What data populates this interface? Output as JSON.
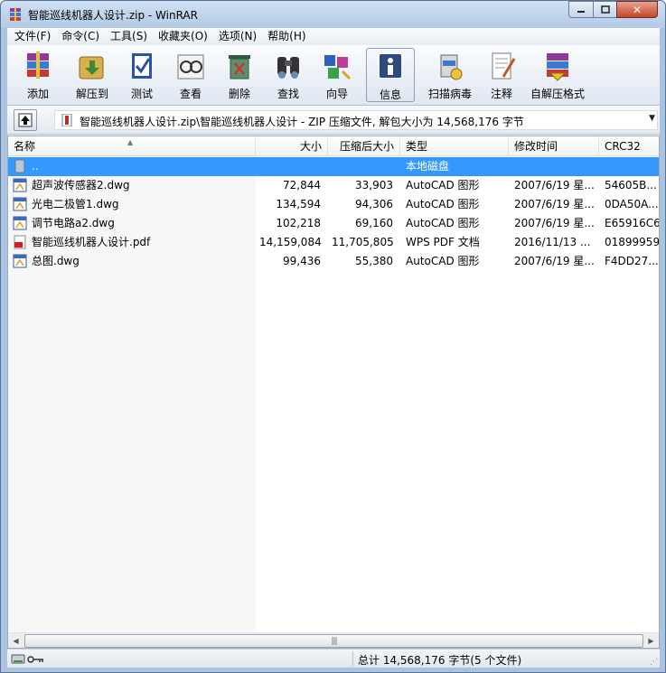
{
  "window": {
    "title": "智能巡线机器人设计.zip - WinRAR"
  },
  "menu": [
    "文件(F)",
    "命令(C)",
    "工具(S)",
    "收藏夹(O)",
    "选项(N)",
    "帮助(H)"
  ],
  "toolbar": [
    {
      "label": "添加",
      "icon": "add-archive-icon"
    },
    {
      "label": "解压到",
      "icon": "extract-to-icon"
    },
    {
      "label": "测试",
      "icon": "test-icon"
    },
    {
      "label": "查看",
      "icon": "view-icon"
    },
    {
      "label": "删除",
      "icon": "delete-icon"
    },
    {
      "label": "查找",
      "icon": "find-icon"
    },
    {
      "label": "向导",
      "icon": "wizard-icon"
    },
    {
      "label": "信息",
      "icon": "info-icon"
    },
    {
      "label": "扫描病毒",
      "icon": "virus-scan-icon"
    },
    {
      "label": "注释",
      "icon": "comment-icon"
    },
    {
      "label": "自解压格式",
      "icon": "sfx-icon"
    }
  ],
  "address": {
    "path": "智能巡线机器人设计.zip\\智能巡线机器人设计 - ZIP 压缩文件, 解包大小为 14,568,176 字节"
  },
  "columns": {
    "name": "名称",
    "size": "大小",
    "packed": "压缩后大小",
    "type": "类型",
    "modified": "修改时间",
    "crc": "CRC32"
  },
  "files": [
    {
      "name": "..",
      "size": "",
      "packed": "",
      "type": "本地磁盘",
      "modified": "",
      "crc": "",
      "icon": "parent-folder-icon"
    },
    {
      "name": "超声波传感器2.dwg",
      "size": "72,844",
      "packed": "33,903",
      "type": "AutoCAD 图形",
      "modified": "2007/6/19 星...",
      "crc": "54605B...",
      "icon": "dwg-file-icon"
    },
    {
      "name": "光电二极管1.dwg",
      "size": "134,594",
      "packed": "94,306",
      "type": "AutoCAD 图形",
      "modified": "2007/6/19 星...",
      "crc": "0DA50A...",
      "icon": "dwg-file-icon"
    },
    {
      "name": "调节电路a2.dwg",
      "size": "102,218",
      "packed": "69,160",
      "type": "AutoCAD 图形",
      "modified": "2007/6/19 星...",
      "crc": "E65916C6",
      "icon": "dwg-file-icon"
    },
    {
      "name": "智能巡线机器人设计.pdf",
      "size": "14,159,084",
      "packed": "11,705,805",
      "type": "WPS PDF 文档",
      "modified": "2016/11/13 ...",
      "crc": "01899959",
      "icon": "pdf-file-icon"
    },
    {
      "name": "总图.dwg",
      "size": "99,436",
      "packed": "55,380",
      "type": "AutoCAD 图形",
      "modified": "2007/6/19 星...",
      "crc": "F4DD27...",
      "icon": "dwg-file-icon"
    }
  ],
  "status": {
    "summary": "总计 14,568,176 字节(5 个文件)"
  },
  "colors": {
    "selection": "#3399ff",
    "titlebar": "#b9d1ea"
  }
}
